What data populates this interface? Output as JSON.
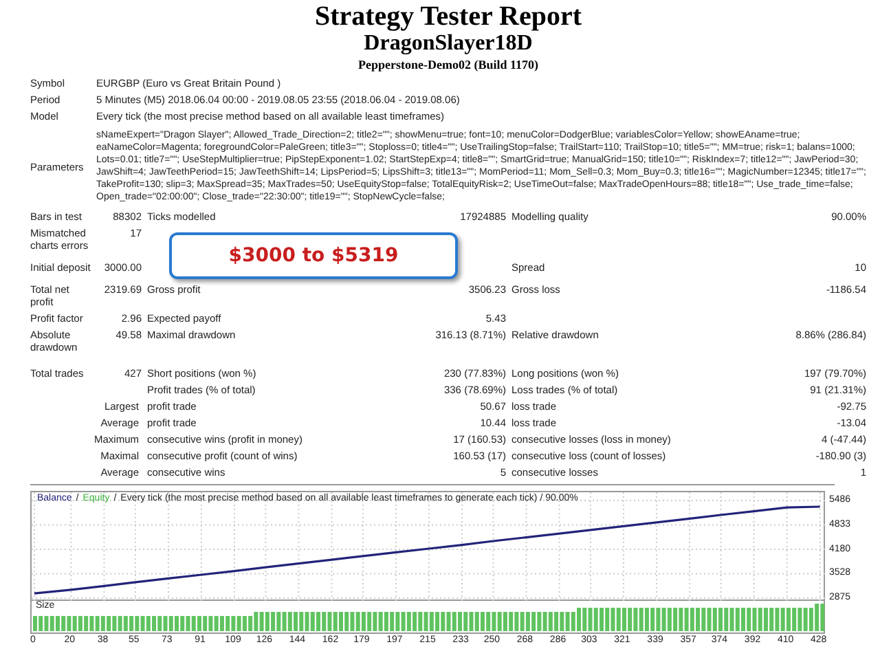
{
  "header": {
    "title": "Strategy Tester Report",
    "expert": "DragonSlayer18D",
    "server": "Pepperstone-Demo02 (Build 1170)"
  },
  "summary": [
    {
      "kind": "wide",
      "label": "Symbol",
      "text": "EURGBP (Euro vs Great Britain Pound )"
    },
    {
      "kind": "wide",
      "label": "Period",
      "text": "5 Minutes (M5) 2018.06.04 00:00 - 2019.08.05 23:55 (2018.06.04 - 2019.08.06)"
    },
    {
      "kind": "wide",
      "label": "Model",
      "text": "Every tick (the most precise method based on all available least timeframes)"
    },
    {
      "kind": "params",
      "label": "Parameters",
      "text": "sNameExpert=\"Dragon Slayer\"; Allowed_Trade_Direction=2; title2=\"\"; showMenu=true; font=10; menuColor=DodgerBlue; variablesColor=Yellow; showEAname=true; eaNameColor=Magenta; foregroundColor=PaleGreen; title3=\"\"; Stoploss=0; title4=\"\"; UseTrailingStop=false; TrailStart=110; TrailStop=10; title5=\"\"; MM=true; risk=1; balans=1000; Lots=0.01; title7=\"\"; UseStepMultiplier=true; PipStepExponent=1.02; StartStepExp=4; title8=\"\"; SmartGrid=true; ManualGrid=150; title10=\"\"; RiskIndex=7; title12=\"\"; JawPeriod=30; JawShift=4; JawTeethPeriod=15; JawTeethShift=14; LipsPeriod=5; LipsShift=3; title13=\"\"; MomPeriod=11; Mom_Sell=0.3; Mom_Buy=0.3; title16=\"\"; MagicNumber=12345; title17=\"\"; TakeProfit=130; slip=3; MaxSpread=35; MaxTrades=50; UseEquityStop=false; TotalEquityRisk=2; UseTimeOut=false; MaxTradeOpenHours=88; title18=\"\"; Use_trade_time=false; Open_trade=\"02:00:00\"; Close_trade=\"22:30:00\"; title19=\"\"; StopNewCycle=false;"
    },
    {
      "kind": "stats",
      "label": "Bars in test",
      "value": "88302",
      "label_2": "Ticks modelled",
      "value_2": "17924885",
      "label_3": "Modelling quality",
      "value_3": "90.00%"
    },
    {
      "kind": "stats",
      "label": "Mismatched charts errors",
      "value": "17",
      "callout": "$3000 to $5319"
    },
    {
      "kind": "stats",
      "label": "Initial deposit",
      "value": "3000.00",
      "label_3": "Spread",
      "value_3": "10"
    },
    {
      "kind": "stats",
      "label": "Total net profit",
      "value": "2319.69",
      "label_2": "Gross profit",
      "value_2": "3506.23",
      "label_3": "Gross loss",
      "value_3": "-1186.54"
    },
    {
      "kind": "stats",
      "label": "Profit factor",
      "value": "2.96",
      "label_2": "Expected payoff",
      "value_2": "5.43"
    },
    {
      "kind": "stats",
      "label": "Absolute drawdown",
      "value": "49.58",
      "label_2": "Maximal drawdown",
      "value_2": "316.13 (8.71%)",
      "label_3": "Relative drawdown",
      "value_3": "8.86% (286.84)"
    }
  ],
  "trades": [
    {
      "kind": "stats",
      "label": "Total trades",
      "value": "427",
      "label_2": "Short positions (won %)",
      "value_2": "230 (77.83%)",
      "label_3": "Long positions (won %)",
      "value_3": "197 (79.70%)"
    },
    {
      "kind": "stats",
      "label_2": "Profit trades (% of total)",
      "value_2": "336 (78.69%)",
      "label_3": "Loss trades (% of total)",
      "value_3": "91 (21.31%)"
    },
    {
      "kind": "sub",
      "label": "Largest",
      "label_2": "profit trade",
      "value_2": "50.67",
      "label_3": "loss trade",
      "value_3": "-92.75"
    },
    {
      "kind": "sub",
      "label": "Average",
      "label_2": "profit trade",
      "value_2": "10.44",
      "label_3": "loss trade",
      "value_3": "-13.04"
    },
    {
      "kind": "sub",
      "label": "Maximum",
      "label_2": "consecutive wins (profit in money)",
      "value_2": "17 (160.53)",
      "label_3": "consecutive losses (loss in money)",
      "value_3": "4 (-47.44)"
    },
    {
      "kind": "sub",
      "label": "Maximal",
      "label_2": "consecutive profit (count of wins)",
      "value_2": "160.53 (17)",
      "label_3": "consecutive loss (count of losses)",
      "value_3": "-180.90 (3)"
    },
    {
      "kind": "sub",
      "label": "Average",
      "label_2": "consecutive wins",
      "value_2": "5",
      "label_3": "consecutive losses",
      "value_3": "1"
    }
  ],
  "chart": {
    "separator": "/",
    "size_label": "Size",
    "legend": [
      {
        "text": "Equity",
        "color": "#3cb43c"
      }
    ],
    "chart_data": {
      "type": "line",
      "grid": true,
      "title": "Every tick (the most precise method based on all available least timeframes to generate each tick) / 90.00%",
      "x": [
        0,
        20,
        38,
        55,
        73,
        91,
        109,
        126,
        144,
        162,
        179,
        197,
        215,
        233,
        250,
        268,
        286,
        303,
        321,
        339,
        357,
        374,
        392,
        410,
        428
      ],
      "series": [
        {
          "name": "Balance",
          "color": "#23237a",
          "values": [
            3000,
            3100,
            3200,
            3300,
            3400,
            3500,
            3600,
            3700,
            3800,
            3900,
            4000,
            4100,
            4200,
            4300,
            4400,
            4500,
            4600,
            4700,
            4800,
            4900,
            5000,
            5100,
            5200,
            5300,
            5320
          ]
        }
      ],
      "xlim": [
        0,
        430
      ],
      "ylim": [
        2875,
        5486
      ],
      "yticks": [
        2875,
        3528,
        4180,
        4833,
        5486
      ],
      "xticks": [
        0,
        20,
        38,
        55,
        73,
        91,
        109,
        126,
        144,
        162,
        179,
        197,
        215,
        233,
        250,
        268,
        286,
        303,
        321,
        339,
        357,
        374,
        392,
        410,
        428
      ]
    }
  }
}
